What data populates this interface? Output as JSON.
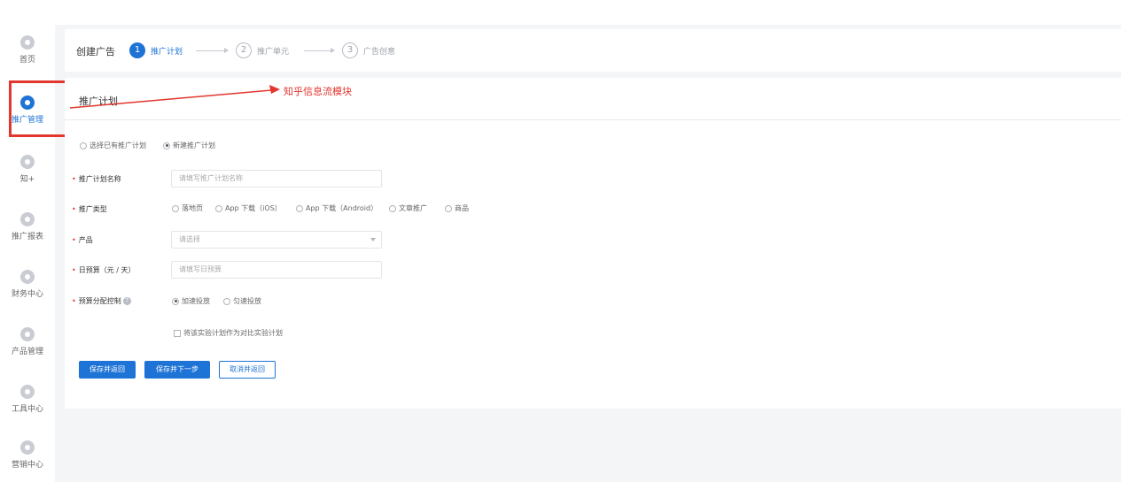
{
  "sidebar": {
    "items": [
      {
        "label": "首页",
        "icon": "home-icon",
        "active": false
      },
      {
        "label": "推广管理",
        "icon": "promotion-icon",
        "active": true
      },
      {
        "label": "知+",
        "icon": "zhiplus-icon",
        "active": false
      },
      {
        "label": "推广报表",
        "icon": "report-icon",
        "active": false
      },
      {
        "label": "财务中心",
        "icon": "finance-icon",
        "active": false
      },
      {
        "label": "产品管理",
        "icon": "product-icon",
        "active": false
      },
      {
        "label": "工具中心",
        "icon": "tools-icon",
        "active": false
      },
      {
        "label": "营销中心",
        "icon": "marketing-icon",
        "active": false
      }
    ]
  },
  "steps": {
    "title": "创建广告",
    "items": [
      {
        "num": "1",
        "label": "推广计划",
        "active": true
      },
      {
        "num": "2",
        "label": "推广单元",
        "active": false
      },
      {
        "num": "3",
        "label": "广告创意",
        "active": false
      }
    ]
  },
  "annotation": "知乎信息流模块",
  "panel": {
    "title": "推广计划",
    "plan_mode": {
      "options": [
        "选择已有推广计划",
        "新建推广计划"
      ],
      "selected": "新建推广计划"
    },
    "fields": {
      "plan_name": {
        "label": "推广计划名称",
        "placeholder": "请填写推广计划名称"
      },
      "promo_type": {
        "label": "推广类型",
        "options": [
          "落地页",
          "App 下载（iOS）",
          "App 下载（Android）",
          "文章推广",
          "商品"
        ]
      },
      "product": {
        "label": "产品",
        "placeholder": "请选择"
      },
      "daily_budget": {
        "label": "日预算（元 / 天）",
        "placeholder": "请填写日预算"
      },
      "budget_control": {
        "label": "预算分配控制",
        "options": [
          "加速投放",
          "匀速投放"
        ],
        "selected": "加速投放"
      },
      "experiment_checkbox": {
        "label": "将该实验计划作为对比实验计划"
      }
    },
    "buttons": {
      "save_return": "保存并返回",
      "save_next": "保存并下一步",
      "cancel_return": "取消并返回"
    }
  },
  "colors": {
    "accent": "#1e73d6",
    "highlight": "#e2362f",
    "background": "#f4f5f7"
  }
}
